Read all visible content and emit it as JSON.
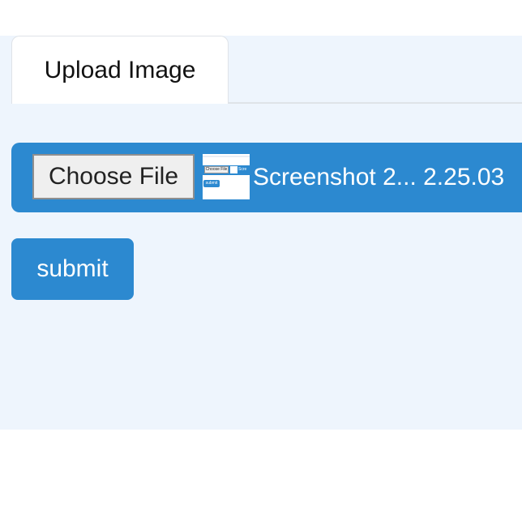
{
  "tabs": [
    {
      "label": "Upload Image",
      "active": true
    }
  ],
  "file_input": {
    "button_label": "Choose File",
    "file_name": "Screenshot 2... 2.25.03",
    "thumbnail": {
      "button_label": "Choose File",
      "file_text": "Scre",
      "submit_label": "submit"
    }
  },
  "actions": {
    "submit_label": "submit"
  },
  "colors": {
    "accent": "#2c89d0",
    "panel_background": "#eef5fd",
    "tab_background": "#ffffff"
  }
}
